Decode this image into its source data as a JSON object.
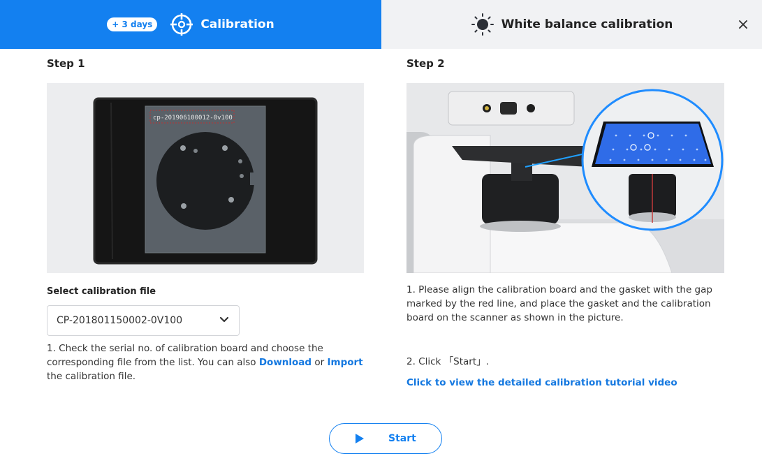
{
  "tabs": {
    "calibration": {
      "badge": "+ 3 days",
      "label": "Calibration"
    },
    "white_balance": {
      "label": "White balance calibration"
    },
    "close": "×"
  },
  "step1": {
    "title": "Step 1",
    "board_serial": "cp-201906100012-0v100",
    "field_label": "Select calibration file",
    "selected_file": "CP-201801150002-0V100",
    "desc_part1": "1. Check the serial no. of calibration board and choose the corresponding file from the list. You can also ",
    "download_link": "Download",
    "desc_part2": " or ",
    "import_link": "Import",
    "desc_part3": " the calibration file."
  },
  "step2": {
    "title": "Step 2",
    "desc1": "1. Please align the calibration board and the gasket with the gap marked by the red line, and place the gasket and the calibration board on the scanner as shown in the picture.",
    "desc2": "2. Click 「Start」.",
    "tutorial_link": "Click to view the detailed calibration tutorial video"
  },
  "start_button": {
    "label": "Start"
  },
  "colors": {
    "accent": "#1380f0",
    "link": "#1478e0",
    "tab_inactive_bg": "#f1f2f4"
  }
}
